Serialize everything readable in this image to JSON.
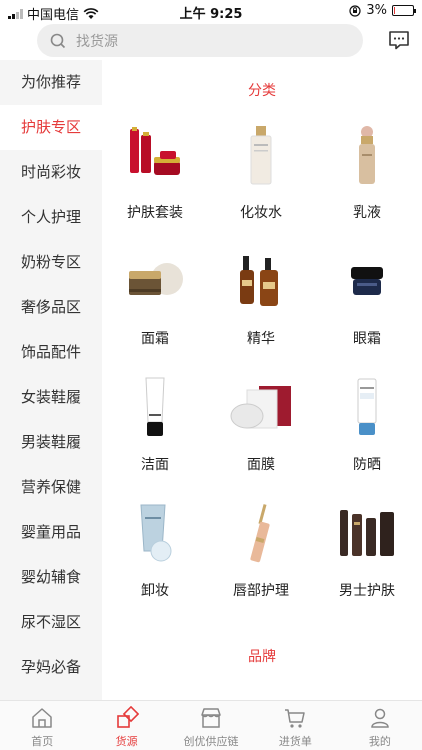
{
  "status_bar": {
    "carrier": "中国电信",
    "time": "上午 9:25",
    "battery": "3%",
    "battery_level": 0.03
  },
  "search": {
    "placeholder": "找货源"
  },
  "sidebar": {
    "items": [
      {
        "label": "为你推荐"
      },
      {
        "label": "护肤专区"
      },
      {
        "label": "时尚彩妆"
      },
      {
        "label": "个人护理"
      },
      {
        "label": "奶粉专区"
      },
      {
        "label": "奢侈品区"
      },
      {
        "label": "饰品配件"
      },
      {
        "label": "女装鞋履"
      },
      {
        "label": "男装鞋履"
      },
      {
        "label": "营养保健"
      },
      {
        "label": "婴童用品"
      },
      {
        "label": "婴幼辅食"
      },
      {
        "label": "尿不湿区"
      },
      {
        "label": "孕妈必备"
      }
    ],
    "active_label": "护肤专区"
  },
  "main": {
    "category_title": "分类",
    "brand_title": "品牌",
    "categories": [
      {
        "label": "护肤套装",
        "icon": "skincare-set-icon"
      },
      {
        "label": "化妆水",
        "icon": "toner-icon"
      },
      {
        "label": "乳液",
        "icon": "lotion-icon"
      },
      {
        "label": "面霜",
        "icon": "face-cream-icon"
      },
      {
        "label": "精华",
        "icon": "serum-icon"
      },
      {
        "label": "眼霜",
        "icon": "eye-cream-icon"
      },
      {
        "label": "洁面",
        "icon": "cleanser-icon"
      },
      {
        "label": "面膜",
        "icon": "face-mask-icon"
      },
      {
        "label": "防晒",
        "icon": "sunscreen-icon"
      },
      {
        "label": "卸妆",
        "icon": "makeup-remover-icon"
      },
      {
        "label": "唇部护理",
        "icon": "lip-care-icon"
      },
      {
        "label": "男士护肤",
        "icon": "mens-skincare-icon"
      }
    ]
  },
  "tabbar": {
    "tabs": [
      {
        "label": "首页",
        "icon": "home-icon"
      },
      {
        "label": "货源",
        "icon": "source-icon"
      },
      {
        "label": "创优供应链",
        "icon": "store-icon"
      },
      {
        "label": "进货单",
        "icon": "cart-icon"
      },
      {
        "label": "我的",
        "icon": "user-icon"
      }
    ],
    "active_label": "货源"
  },
  "colors": {
    "accent": "#e53b3b",
    "sidebar_bg": "#f5f5f5",
    "search_bg": "#eeeeee"
  }
}
